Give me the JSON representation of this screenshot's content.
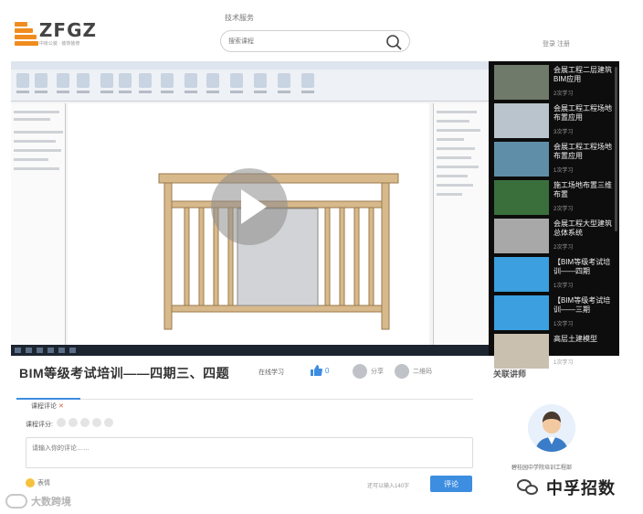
{
  "header": {
    "logo_title": "ZFGZ",
    "logo_sub": "中房公装 · 装饰装修",
    "top_link": "技术服务",
    "search_placeholder": "搜索课程",
    "login": "登录 注册"
  },
  "video": {
    "title": "BIM等级考试培训——四期三、四题",
    "study_button": "在线学习",
    "like_count": "0",
    "share_label": "分享",
    "qrcode_label": "二维码",
    "playlist": [
      {
        "title": "会展工程二层建筑BIM应用",
        "count": "2次学习",
        "thumb": "#6f7a6a"
      },
      {
        "title": "会展工程工程场地布置应用",
        "count": "3次学习",
        "thumb": "#b9c4cc"
      },
      {
        "title": "会展工程工程场地布置应用",
        "count": "1次学习",
        "thumb": "#5f8fa8"
      },
      {
        "title": "施工场地布置三维布置",
        "count": "2次学习",
        "thumb": "#3a6f3c"
      },
      {
        "title": "会展工程大型建筑总体系统",
        "count": "2次学习",
        "thumb": "#a8a8a8"
      },
      {
        "title": "【BIM等级考试培训——四期",
        "count": "1次学习",
        "thumb": "#3b9fe0"
      },
      {
        "title": "【BIM等级考试培训——三期",
        "count": "1次学习",
        "thumb": "#3b9fe0"
      },
      {
        "title": "高层土建模型",
        "count": "1次学习",
        "thumb": "#c9c0b0"
      }
    ]
  },
  "related": {
    "title": "关联讲师",
    "author": "碧桂园中学院培训工程部"
  },
  "comment": {
    "tab_label": "课程评论",
    "tab_close": "✕",
    "rate_label": "课程评分:",
    "placeholder": "请输入你的评论……",
    "emoji_label": "表情",
    "char_count": "还可以输入140字",
    "submit_label": "评论"
  },
  "watermarks": {
    "left": "大数跨境",
    "right": "中孚招数"
  },
  "colors": {
    "accent": "#3d8de0",
    "logo_orange": "#f08c1e",
    "railing_wood": "#d8b98c"
  }
}
